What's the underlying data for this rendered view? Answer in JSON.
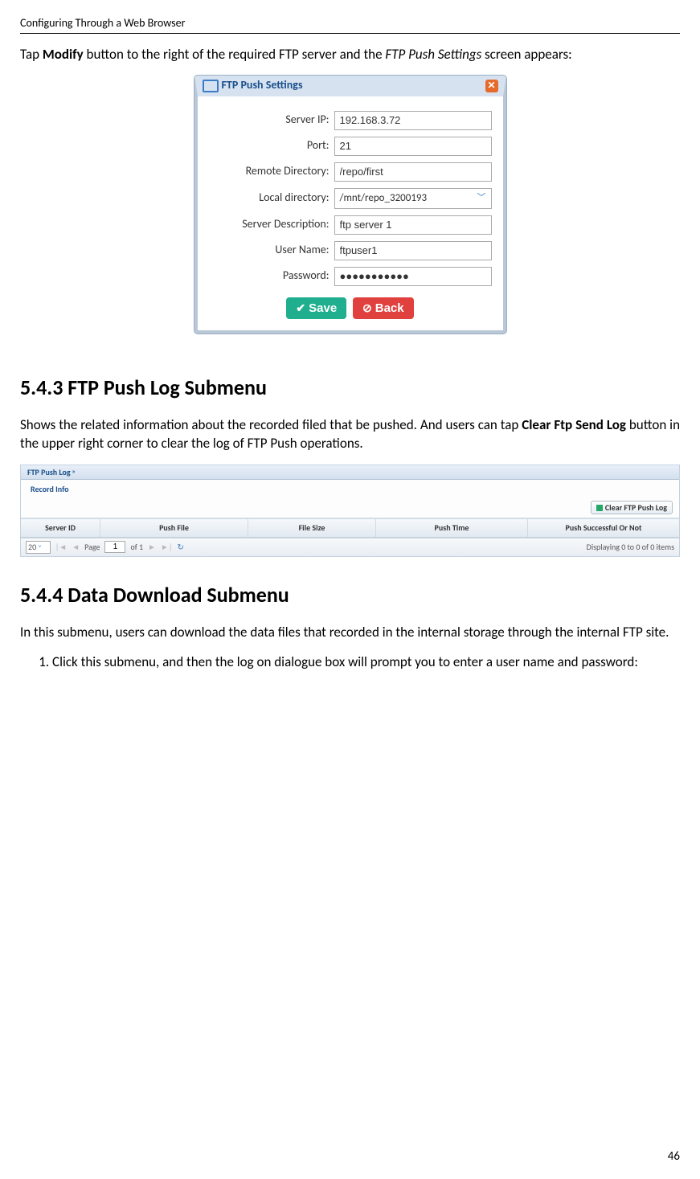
{
  "header": {
    "left": "Configuring Through a Web Browser"
  },
  "intro": {
    "pre": "Tap ",
    "bold": "Modify",
    "mid": " button to the right of the required FTP server and the ",
    "ital": "FTP Push Settings",
    "post": " screen appears:"
  },
  "dialog": {
    "title": "FTP Push Settings",
    "labels": {
      "server_ip": "Server IP:",
      "port": "Port:",
      "remote_dir": "Remote Directory:",
      "local_dir": "Local directory:",
      "server_desc": "Server Description:",
      "user_name": "User Name:",
      "password": "Password:"
    },
    "values": {
      "server_ip": "192.168.3.72",
      "port": "21",
      "remote_dir": "/repo/first",
      "local_dir": "/mnt/repo_3200193",
      "server_desc": "ftp server 1",
      "user_name": "ftpuser1",
      "password": "●●●●●●●●●●●"
    },
    "buttons": {
      "save": "Save",
      "back": "Back"
    }
  },
  "section1": {
    "heading": "5.4.3 FTP Push Log Submenu",
    "para_pre": "Shows the related information about the recorded filed that be pushed. And users can tap ",
    "para_bold": "Clear Ftp Send Log",
    "para_post": " button in the upper right corner to clear the log of FTP Push operations."
  },
  "logpanel": {
    "tab": "FTP Push Log",
    "record_info": "Record Info",
    "clear_btn": "Clear FTP Push Log",
    "cols": {
      "c1": "Server ID",
      "c2": "Push File",
      "c3": "File Size",
      "c4": "Push Time",
      "c5": "Push Successful Or Not"
    },
    "pager": {
      "size": "20",
      "page_lbl": "Page",
      "page_val": "1",
      "of_lbl": "of 1",
      "status": "Displaying 0 to 0 of 0 items"
    }
  },
  "section2": {
    "heading": "5.4.4 Data Download Submenu",
    "para": "In this submenu, users can download the data files that recorded in the internal storage through the internal FTP site.",
    "li1": "Click this submenu, and then the log on dialogue box will prompt you to enter a user name and password:"
  },
  "page_number": "46"
}
